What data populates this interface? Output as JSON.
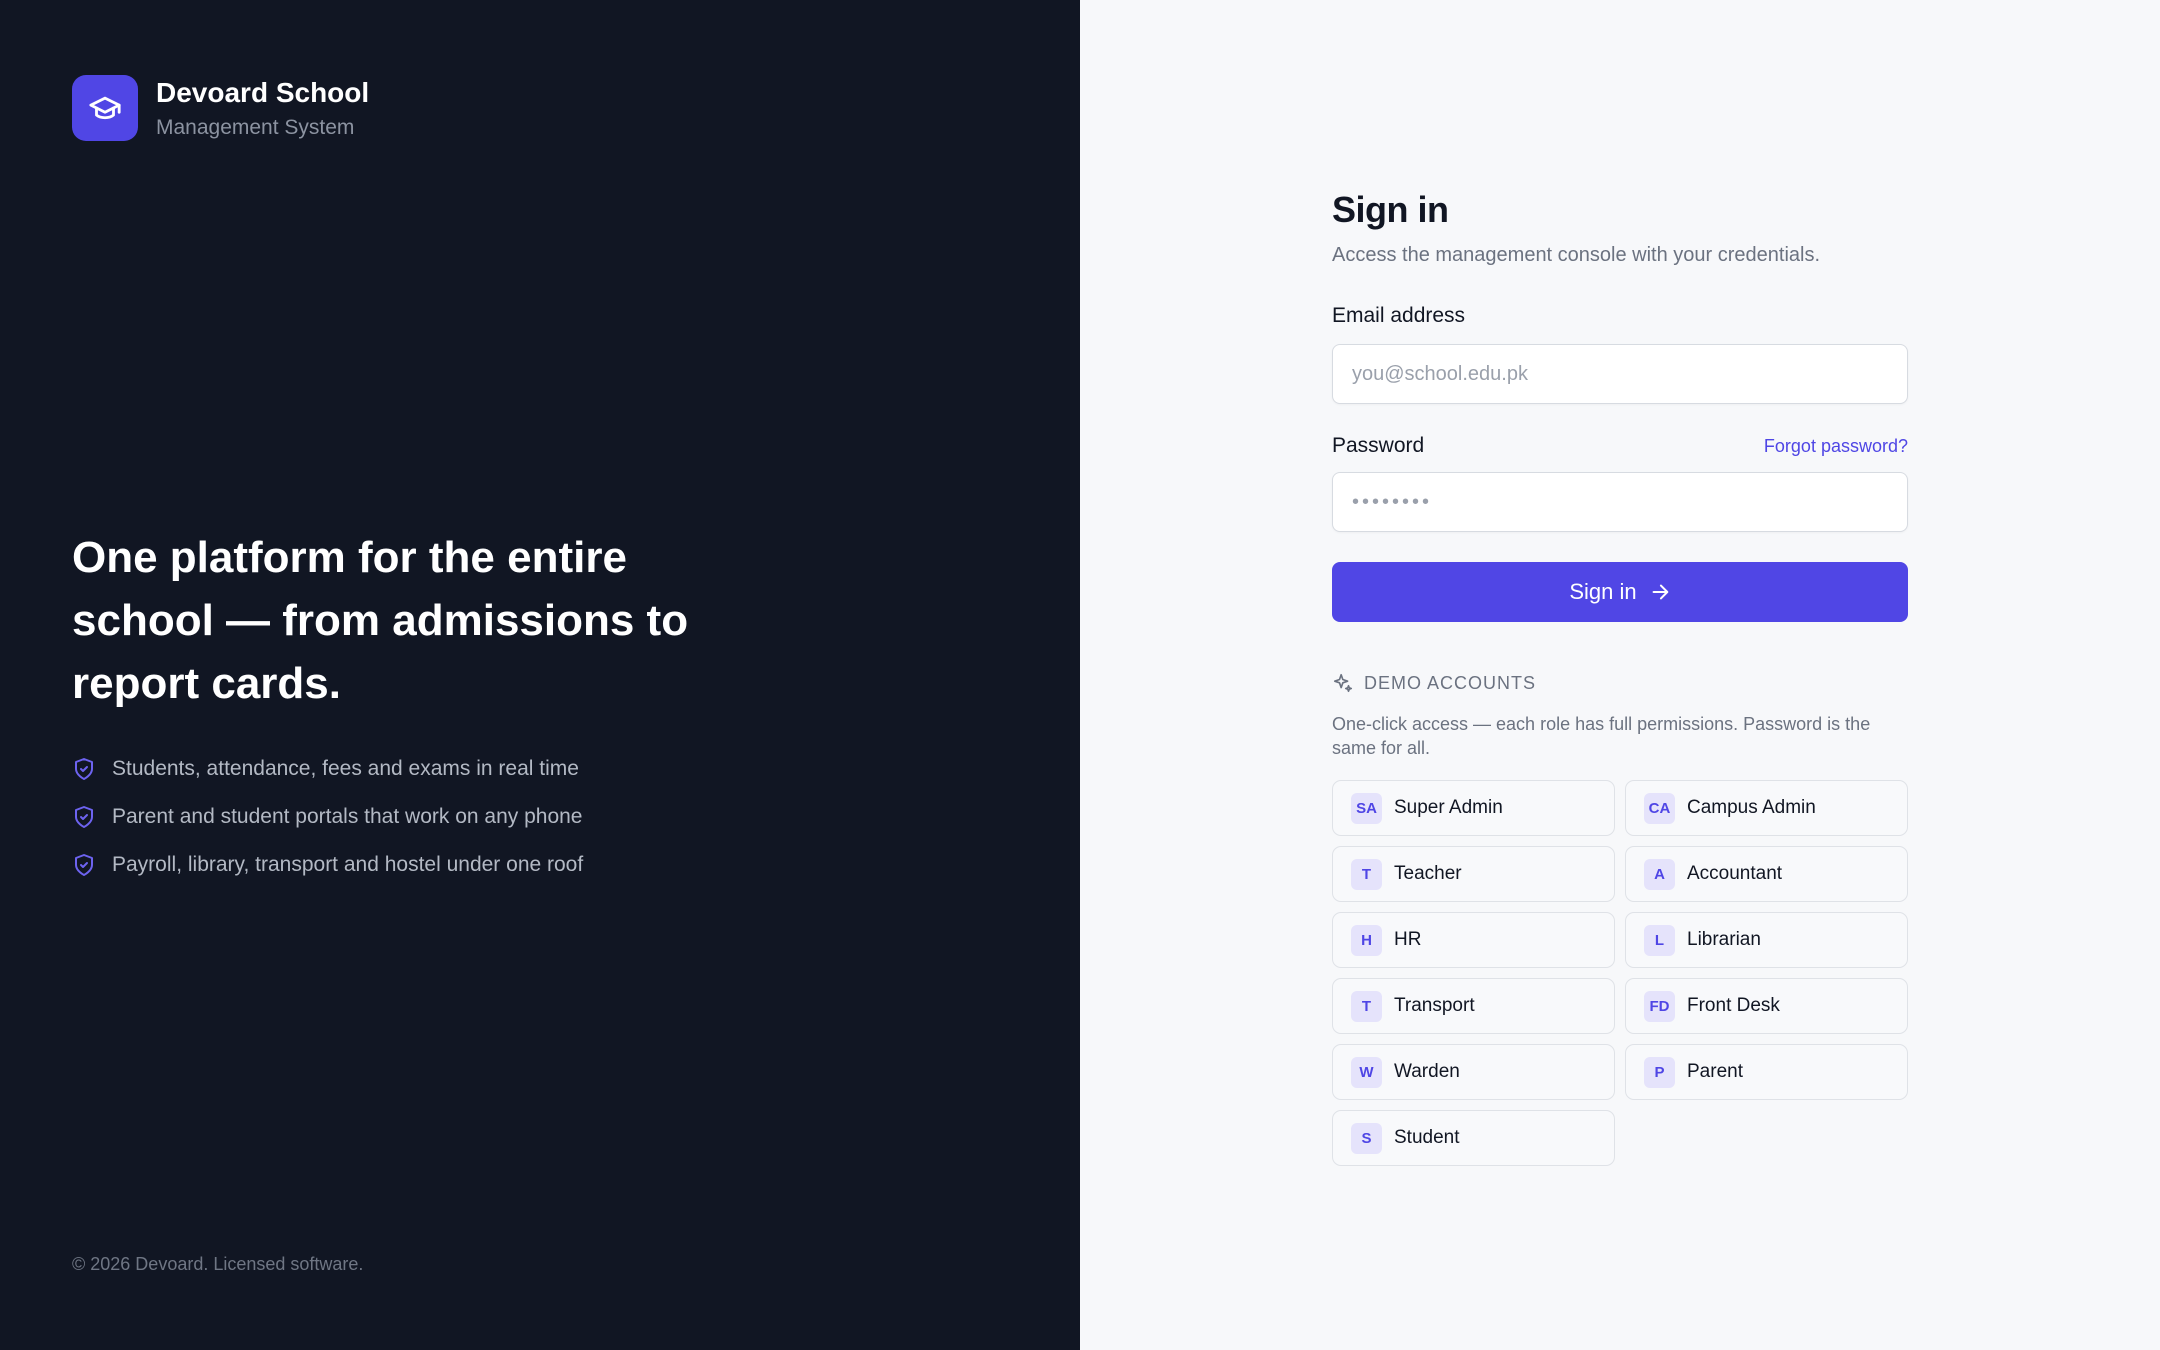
{
  "brand": {
    "name": "Devoard School",
    "subtitle": "Management System"
  },
  "hero": {
    "headline": "One platform for the entire school — from admissions to report cards."
  },
  "features": [
    "Students, attendance, fees and exams in real time",
    "Parent and student portals that work on any phone",
    "Payroll, library, transport and hostel under one roof"
  ],
  "footer": {
    "copyright": "© 2026 Devoard. Licensed software."
  },
  "signin": {
    "title": "Sign in",
    "subtitle": "Access the management console with your credentials.",
    "email_label": "Email address",
    "email_value": "",
    "email_placeholder": "you@school.edu.pk",
    "password_label": "Password",
    "password_value": "",
    "password_placeholder": "••••••••",
    "forgot_label": "Forgot password?",
    "submit_label": "Sign in"
  },
  "demo": {
    "title": "DEMO ACCOUNTS",
    "description": "One-click access — each role has full permissions. Password is the same for all.",
    "accounts": [
      {
        "initials": "SA",
        "name": "Super Admin"
      },
      {
        "initials": "CA",
        "name": "Campus Admin"
      },
      {
        "initials": "T",
        "name": "Teacher"
      },
      {
        "initials": "A",
        "name": "Accountant"
      },
      {
        "initials": "H",
        "name": "HR"
      },
      {
        "initials": "L",
        "name": "Librarian"
      },
      {
        "initials": "T",
        "name": "Transport"
      },
      {
        "initials": "FD",
        "name": "Front Desk"
      },
      {
        "initials": "W",
        "name": "Warden"
      },
      {
        "initials": "P",
        "name": "Parent"
      },
      {
        "initials": "S",
        "name": "Student"
      }
    ]
  },
  "colors": {
    "accent": "#5046e5",
    "dark_panel": "#111623",
    "light_panel": "#f7f8fa"
  },
  "icons": {
    "logo": "graduation-cap-icon",
    "feature": "shield-check-icon",
    "submit": "arrow-right-icon",
    "demo": "sparkles-icon"
  }
}
